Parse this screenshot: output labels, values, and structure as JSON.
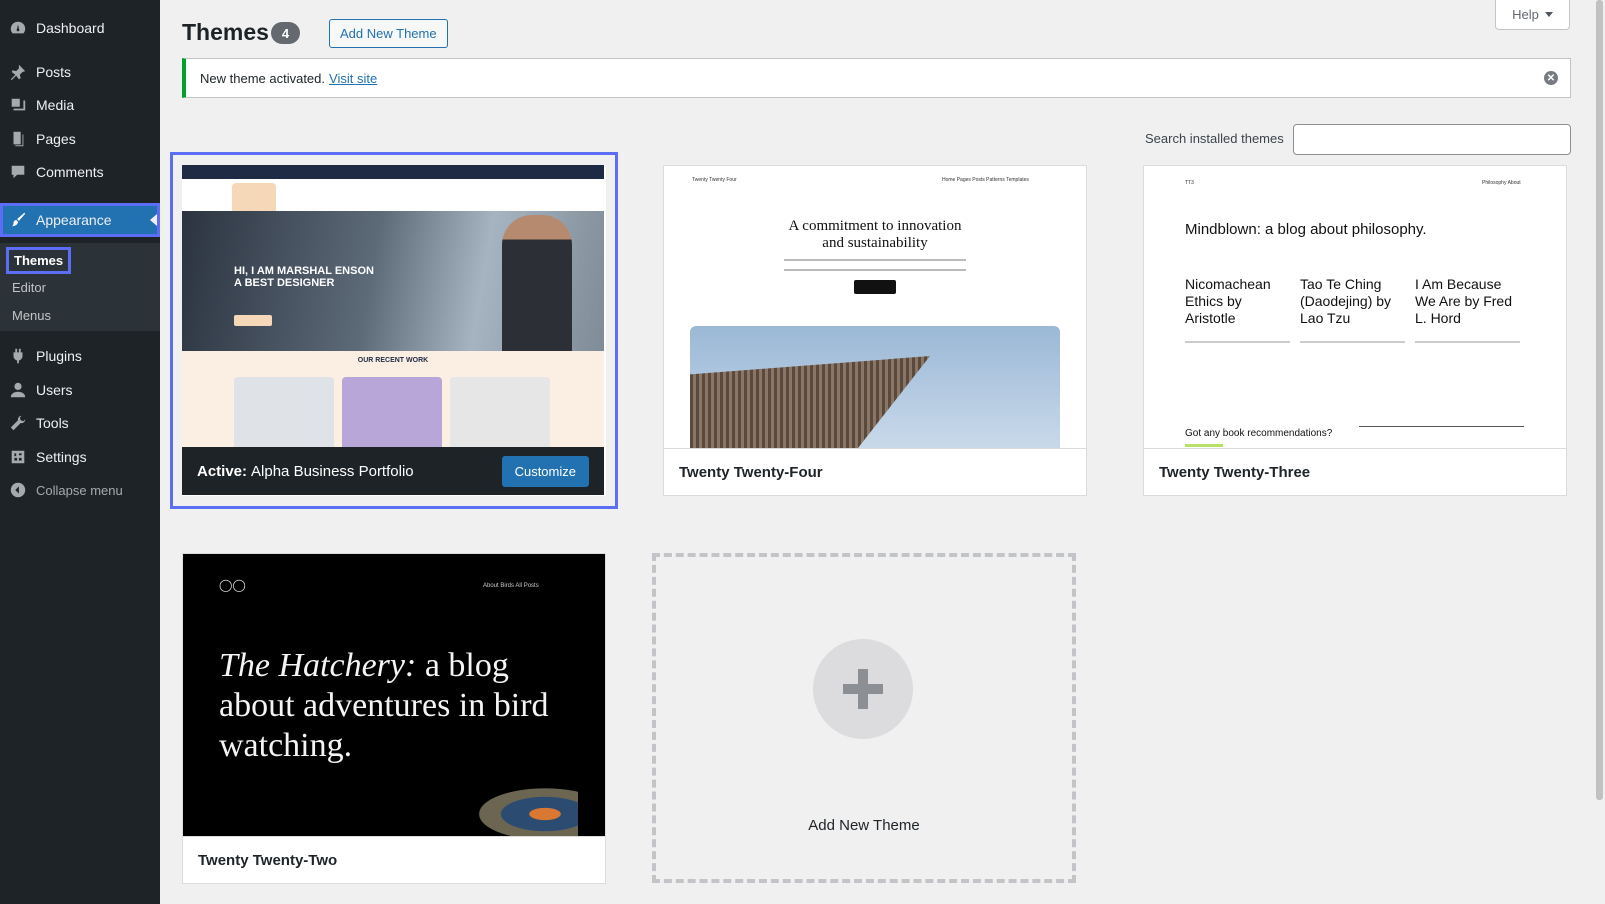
{
  "sidebar": {
    "items": [
      {
        "label": "Dashboard",
        "icon": "dashboard-icon"
      },
      {
        "label": "Posts",
        "icon": "pin-icon"
      },
      {
        "label": "Media",
        "icon": "media-icon"
      },
      {
        "label": "Pages",
        "icon": "page-icon"
      },
      {
        "label": "Comments",
        "icon": "comment-icon"
      },
      {
        "label": "Appearance",
        "icon": "paintbrush-icon"
      },
      {
        "label": "Plugins",
        "icon": "plugin-icon"
      },
      {
        "label": "Users",
        "icon": "user-icon"
      },
      {
        "label": "Tools",
        "icon": "wrench-icon"
      },
      {
        "label": "Settings",
        "icon": "settings-icon"
      }
    ],
    "submenu": [
      "Themes",
      "Editor",
      "Menus"
    ],
    "collapse_label": "Collapse menu"
  },
  "header": {
    "title": "Themes",
    "count": "4",
    "add_new_label": "Add New Theme",
    "help_label": "Help"
  },
  "notice": {
    "text": "New theme activated.",
    "link": "Visit site"
  },
  "search": {
    "label": "Search installed themes",
    "value": ""
  },
  "themes": {
    "active": {
      "prefix": "Active:",
      "name": "Alpha Business Portfolio",
      "customize_label": "Customize"
    },
    "four": {
      "name": "Twenty Twenty-Four"
    },
    "three": {
      "name": "Twenty Twenty-Three"
    },
    "two": {
      "name": "Twenty Twenty-Two"
    }
  },
  "previews": {
    "portfolio": {
      "headline_1": "HI, I AM MARSHAL ENSON",
      "headline_2": "A BEST DESIGNER",
      "section": "OUR RECENT WORK"
    },
    "tt4": {
      "site": "Twenty Twenty Four",
      "nav": "Home   Pages   Posts   Patterns   Templates",
      "heading_1": "A commitment to innovation",
      "heading_2": "and sustainability"
    },
    "tt3": {
      "site": "TT3",
      "nav": "Philosophy   About",
      "heading": "Mindblown: a blog about philosophy.",
      "col_1": "Nicomachean Ethics by Aristotle",
      "col_2": "Tao Te Ching (Daodejing) by Lao Tzu",
      "col_3": "I Am Because We Are by Fred L. Hord",
      "footer": "Got any book recommendations?"
    },
    "tt2": {
      "nav": "About    Birds    All Posts",
      "heading_em": "The Hatchery:",
      "heading_rest": " a blog about adventures in bird watching."
    }
  },
  "add_new_card": {
    "label": "Add New Theme"
  },
  "colors": {
    "accent": "#2271b1",
    "sidebar": "#1d2327",
    "highlight": "#5b6ef5",
    "success": "#00a32a"
  }
}
